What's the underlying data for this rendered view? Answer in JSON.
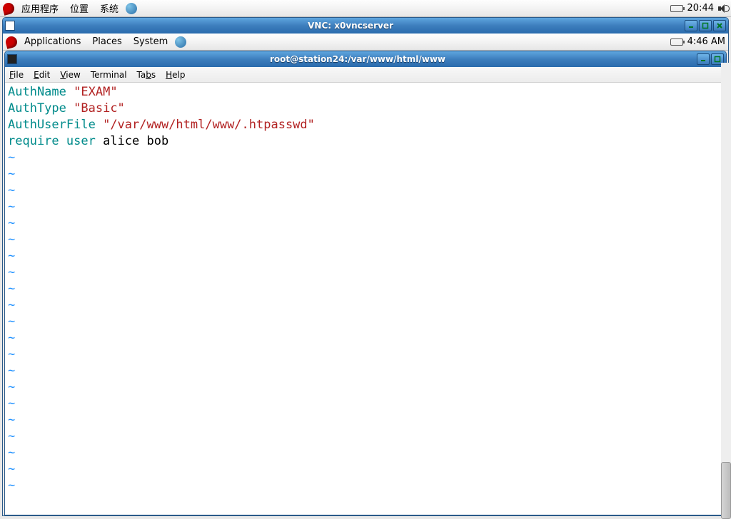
{
  "outer_panel": {
    "menu_apps": "应用程序",
    "menu_places": "位置",
    "menu_system": "系统",
    "clock": "20:44"
  },
  "vnc_window": {
    "title": "VNC: x0vncserver"
  },
  "inner_panel": {
    "menu_apps": "Applications",
    "menu_places": "Places",
    "menu_system": "System",
    "clock": "4:46 AM"
  },
  "terminal": {
    "title": "root@station24:/var/www/html/www",
    "menu": {
      "file": "File",
      "edit": "Edit",
      "view": "View",
      "terminal": "Terminal",
      "tabs": "Tabs",
      "help": "Help"
    },
    "content": {
      "line1_kw": "AuthName",
      "line1_str": "\"EXAM\"",
      "line2_kw": "AuthType",
      "line2_str": "\"Basic\"",
      "line3_kw": "AuthUserFile",
      "line3_str": "\"/var/www/html/www/.htpasswd\"",
      "line4_kw": "require user",
      "line4_txt": " alice bob",
      "tilde": "~"
    }
  }
}
